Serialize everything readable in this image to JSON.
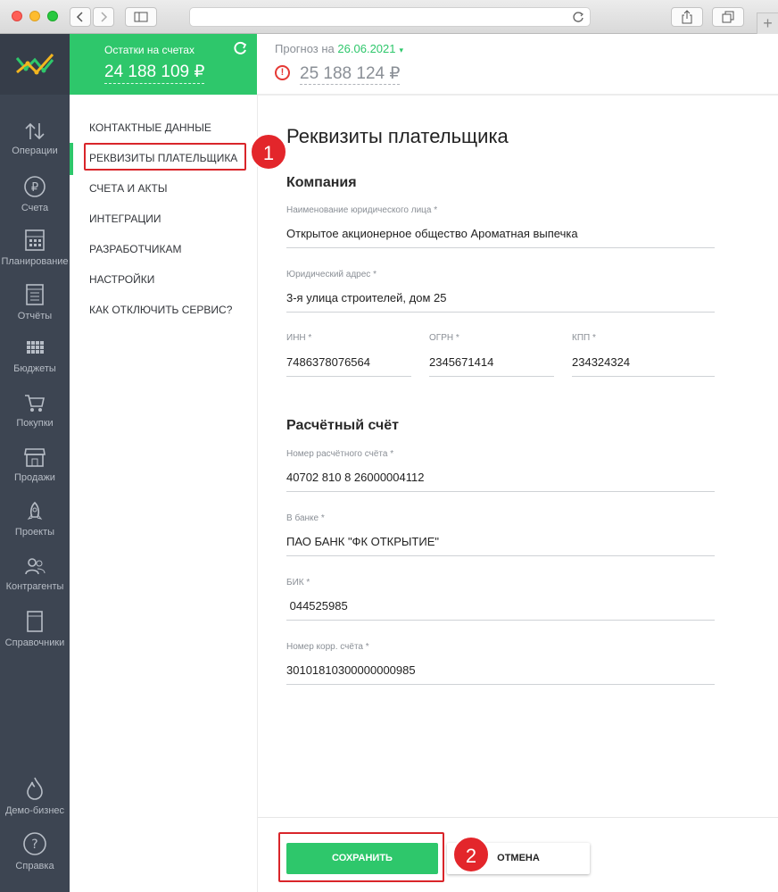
{
  "balance": {
    "label": "Остатки на счетах",
    "amount": "24 188 109 ₽"
  },
  "forecast": {
    "label": "Прогноз на",
    "date": "26.06.2021",
    "caret": "▾",
    "warning": "!",
    "amount": "25 188 124 ₽"
  },
  "rail": [
    {
      "label": "Операции",
      "icon": "arrows-updown-icon"
    },
    {
      "label": "Счета",
      "icon": "ruble-circle-icon"
    },
    {
      "label": "Планирование",
      "icon": "calculator-icon"
    },
    {
      "label": "Отчёты",
      "icon": "report-icon"
    },
    {
      "label": "Бюджеты",
      "icon": "grid-icon"
    },
    {
      "label": "Покупки",
      "icon": "cart-icon"
    },
    {
      "label": "Продажи",
      "icon": "shop-icon"
    },
    {
      "label": "Проекты",
      "icon": "rocket-icon"
    },
    {
      "label": "Контрагенты",
      "icon": "people-icon"
    },
    {
      "label": "Справочники",
      "icon": "book-icon"
    },
    {
      "label": "Демо-бизнес",
      "icon": "flame-icon"
    },
    {
      "label": "Справка",
      "icon": "help-circle-icon"
    }
  ],
  "menu": [
    {
      "label": "КОНТАКТНЫЕ ДАННЫЕ"
    },
    {
      "label": "РЕКВИЗИТЫ ПЛАТЕЛЬЩИКА"
    },
    {
      "label": "СЧЕТА И АКТЫ"
    },
    {
      "label": "ИНТЕГРАЦИИ"
    },
    {
      "label": "РАЗРАБОТЧИКАМ"
    },
    {
      "label": "НАСТРОЙКИ"
    },
    {
      "label": "КАК ОТКЛЮЧИТЬ СЕРВИС?"
    }
  ],
  "annotations": {
    "badge1": "1",
    "badge2": "2"
  },
  "page": {
    "title": "Реквизиты плательщика",
    "company_section": "Компания",
    "account_section": "Расчётный счёт"
  },
  "fields": {
    "name": {
      "label": "Наименование юридического лица *",
      "value": "Открытое акционерное общество Ароматная выпечка"
    },
    "address": {
      "label": "Юридический адрес *",
      "value": "3-я улица строителей, дом 25"
    },
    "inn": {
      "label": "ИНН *",
      "value": "7486378076564"
    },
    "ogrn": {
      "label": "ОГРН *",
      "value": "2345671414"
    },
    "kpp": {
      "label": "КПП *",
      "value": "234324324"
    },
    "account": {
      "label": "Номер расчётного счёта *",
      "value": "40702 810 8 26000004112"
    },
    "bank": {
      "label": "В банке *",
      "value": "ПАО БАНК \"ФК ОТКРЫТИЕ\""
    },
    "bik": {
      "label": "БИК *",
      "value": " 044525985"
    },
    "corr": {
      "label": "Номер корр. счёта *",
      "value": "30101810300000000985"
    }
  },
  "buttons": {
    "save": "СОХРАНИТЬ",
    "cancel": "ОТМЕНА"
  },
  "colors": {
    "accent": "#2ec76b",
    "rail": "#3d4552",
    "highlight": "#d9252a",
    "warning": "#e53935"
  }
}
